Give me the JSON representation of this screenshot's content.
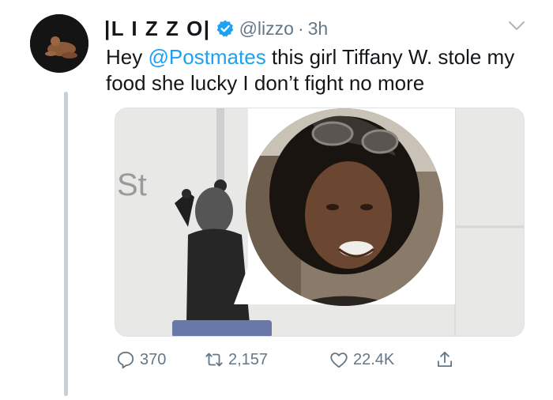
{
  "author": {
    "display_name": "|L I Z Z O|",
    "handle": "@lizzo",
    "separator": "·",
    "time": "3h"
  },
  "tweet": {
    "text_before": "Hey ",
    "mention": "@Postmates",
    "text_after": " this girl Tiffany W. stole my food she lucky I don’t fight no more"
  },
  "media": {
    "sign_text": "St"
  },
  "actions": {
    "replies": "370",
    "retweets": "2,157",
    "likes": "22.4K"
  },
  "colors": {
    "accent": "#1da1f2",
    "muted": "#657786",
    "text": "#14171a"
  }
}
